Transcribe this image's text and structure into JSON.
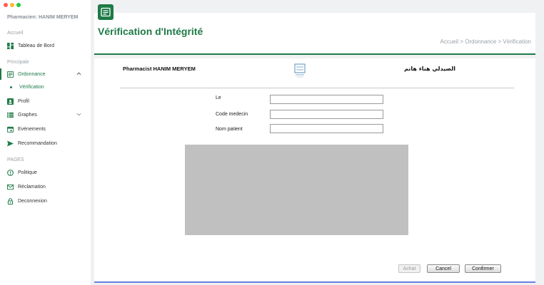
{
  "window": {
    "controls": [
      "close",
      "minimize",
      "maximize"
    ]
  },
  "sidebar": {
    "user_label": "Pharmacien: HANIM MERYEM",
    "sections": {
      "home": "Accueil",
      "main": "Principale",
      "pages": "PAGES"
    },
    "items": {
      "dashboard": {
        "label": "Tableau de Bord",
        "icon": "dashboard-icon"
      },
      "ordonnance": {
        "label": "Ordonnance",
        "icon": "list-icon"
      },
      "verification": {
        "label": "Vérification"
      },
      "profil": {
        "label": "Profil",
        "icon": "profile-icon"
      },
      "graphes": {
        "label": "Graphes",
        "icon": "chart-icon"
      },
      "evenements": {
        "label": "Evénements",
        "icon": "calendar-icon"
      },
      "recommandation": {
        "label": "Recommandation",
        "icon": "send-icon"
      },
      "politique": {
        "label": "Politique",
        "icon": "info-icon"
      },
      "reclamation": {
        "label": "Réclamation",
        "icon": "mail-icon"
      },
      "deconnexion": {
        "label": "Deconnexion",
        "icon": "lock-icon"
      }
    }
  },
  "header": {
    "title": "Vérification d'Intégrité",
    "breadcrumb": "Accueil > Ordonnance > Vérification"
  },
  "prescription": {
    "pharmacist_name": "Pharmacist HANIM MERYEM",
    "pharmacist_name_arabic": "الصيدلي هناء هانم",
    "fields": {
      "le": {
        "label": "Le",
        "value": ""
      },
      "code_medecin": {
        "label": "Code medecin",
        "value": ""
      },
      "nom_patient": {
        "label": "Nom patient",
        "value": ""
      }
    }
  },
  "actions": {
    "achat": "Achat",
    "cancel": "Cancel",
    "confirm": "Confirmer"
  },
  "colors": {
    "accent": "#1e7a46",
    "card_bottom_border": "#6a7fe0",
    "image_placeholder": "#c0c0c0"
  }
}
